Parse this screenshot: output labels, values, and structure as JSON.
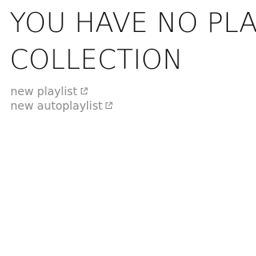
{
  "heading": {
    "line1": "YOU HAVE NO PLAYLISTS IN YOUR",
    "line2": "COLLECTION"
  },
  "links": {
    "new_playlist": "new playlist",
    "new_autoplaylist": "new autoplaylist"
  },
  "icons": {
    "link_icon": "external-link-icon"
  },
  "colors": {
    "heading_text": "#111111",
    "link_text": "#8a8a8a",
    "background": "#ffffff"
  }
}
